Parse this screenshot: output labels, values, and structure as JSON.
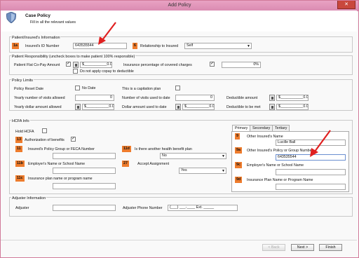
{
  "window": {
    "title": "Add Policy",
    "close_label": "✕"
  },
  "header": {
    "title": "Case Policy",
    "subtitle": "Fill in all the relevant values"
  },
  "insured_info": {
    "section_title": "Patient/Insured's Information",
    "badge_id": "1a",
    "id_label": "Insured's ID Number",
    "id_value": "643535544",
    "badge_rel": "6",
    "rel_label": "Relationship to Insured",
    "rel_value": "Self"
  },
  "responsibility": {
    "section_title": "Patient Responsibility (uncheck boxes to make patient 100% responsible)",
    "copay_label": "Patient Flat Co-Pay Amount",
    "copay_value": "$___________0.00",
    "no_copay_label": "Do not apply copay to deductible",
    "pct_label": "Insurance percentage of covered charges",
    "pct_value": "0%"
  },
  "limits": {
    "section_title": "Policy Limits",
    "reset_label": "Policy Reset Date",
    "no_date_label": "No Date",
    "capitation_label": "This is a capitation plan",
    "yearly_visits_label": "Yearly number of visits allowed",
    "yearly_visits_value": "0",
    "visits_used_label": "Number of visits used to date",
    "visits_used_value": "0",
    "deductible_label": "Deductible amount",
    "deductible_value": "$___________0.00",
    "yearly_dollar_label": "Yearly dollar amount allowed",
    "yearly_dollar_value": "$___________0.00",
    "dollar_used_label": "Dollar amount used to date",
    "dollar_used_value": "$___________0.00",
    "deductible_met_label": "Deductible to be met",
    "deductible_met_value": "$___________0.00"
  },
  "hcfa": {
    "section_title": "HCFA Info",
    "hold_label": "Hold HCFA",
    "badge_13": "13",
    "auth_label": "Authorization of benefits",
    "badge_11": "11",
    "group_label": "Insured's Policy Group or FECA Number",
    "badge_11d": "11d",
    "other_plan_label": "Is there another health benefit plan",
    "other_plan_value": "No",
    "badge_11b": "11b",
    "employer_label": "Employer's Name or School Name",
    "badge_27": "27",
    "accept_label": "Accept Assignment",
    "accept_value": "Yes",
    "badge_11c": "11c",
    "plan_name_label": "Insurance plan name or program name"
  },
  "tabs": [
    "Primary",
    "Secondary",
    "Tertiary"
  ],
  "primary_tab": {
    "badge_9": "9",
    "other_name_label": "Other Insured's Name",
    "other_name_value": "Lucille Ball",
    "badge_9a": "9a",
    "other_policy_label": "Other Insured's Policy or Group Number",
    "other_policy_value": "643535544",
    "badge_9c": "9c",
    "employer_label": "Employer's Name or School Name",
    "badge_9d": "9d",
    "plan_label": "Insurance Plan Name or Program Name"
  },
  "adjuster": {
    "section_title": "Adjuster Information",
    "adjuster_label": "Adjuster",
    "phone_label": "Adjuster Phone Number",
    "phone_value": "(___) ___-____ Ext. _____"
  },
  "footer": {
    "back_label": "< Back",
    "next_label": "Next >",
    "finish_label": "Finish"
  },
  "colors": {
    "badge": "#ee7c2d",
    "arrow": "#e02020",
    "titlebar": "#d98ab0"
  }
}
